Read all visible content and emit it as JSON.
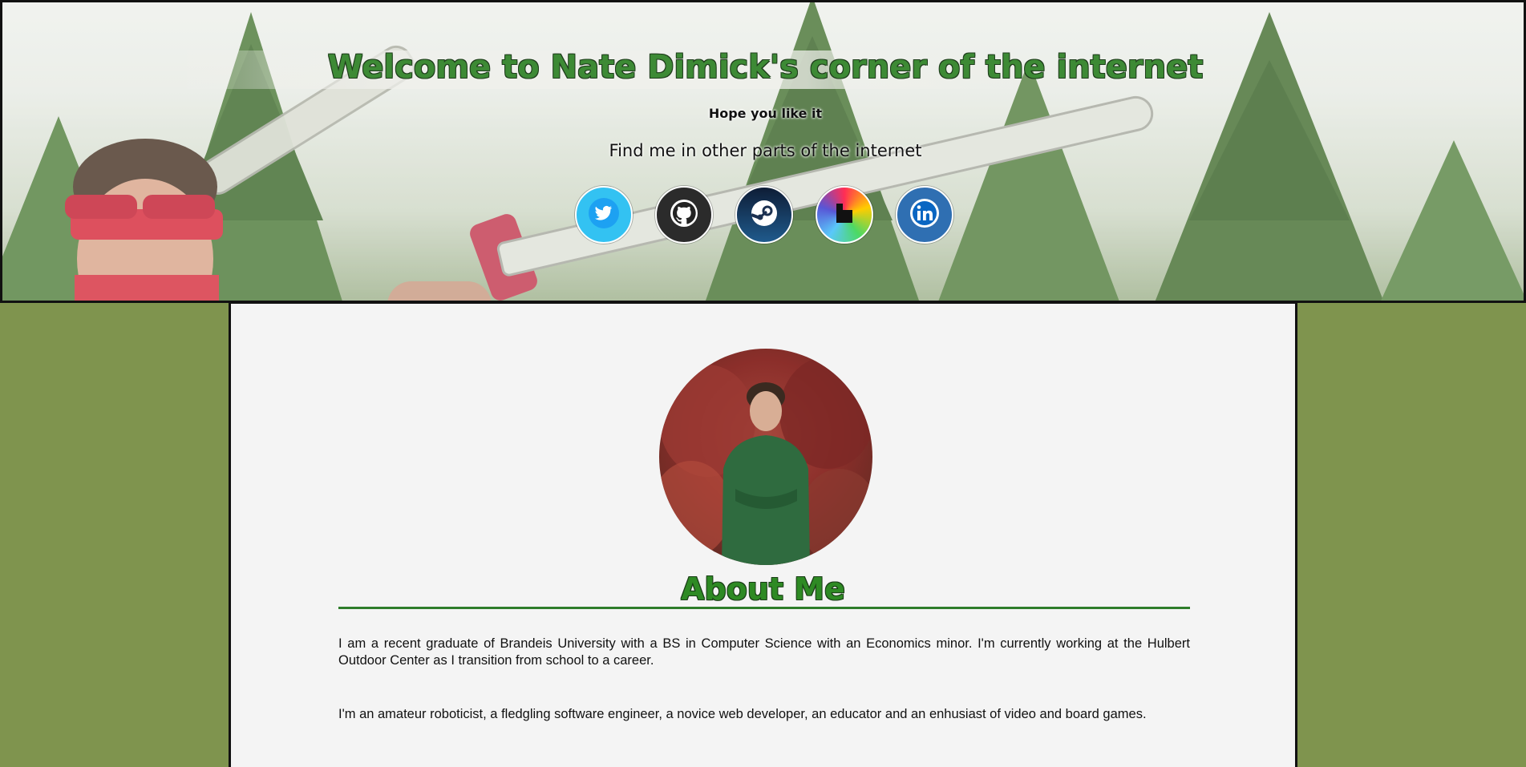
{
  "header": {
    "title": "Welcome to Nate Dimick's corner of the internet",
    "subtitle": "Hope you like it",
    "find_me": "Find me in other parts of the internet"
  },
  "socials": [
    {
      "name": "twitter",
      "icon": "twitter-icon",
      "color": "#33c2f2"
    },
    {
      "name": "github",
      "icon": "github-icon",
      "color": "#2b2b2b"
    },
    {
      "name": "steam",
      "icon": "steam-icon",
      "color": "#15345a"
    },
    {
      "name": "itch",
      "icon": "itch-icon",
      "color": "#ff3b8b"
    },
    {
      "name": "linkedin",
      "icon": "linkedin-icon",
      "color": "#2f6fb2"
    }
  ],
  "about": {
    "title": "About Me",
    "paragraphs": [
      "I am a recent graduate of Brandeis University with a BS in Computer Science with an Economics minor. I'm currently working at the Hulbert Outdoor Center as I transition from school to a career.",
      "I'm an amateur roboticist, a fledgling software engineer, a novice web developer, an educator and an enhusiast of video and board games."
    ]
  },
  "colors": {
    "page_background": "#7f944e",
    "title_green": "#3d8a35",
    "rule_green": "#2e7d2a",
    "content_background": "#f4f4f4"
  }
}
